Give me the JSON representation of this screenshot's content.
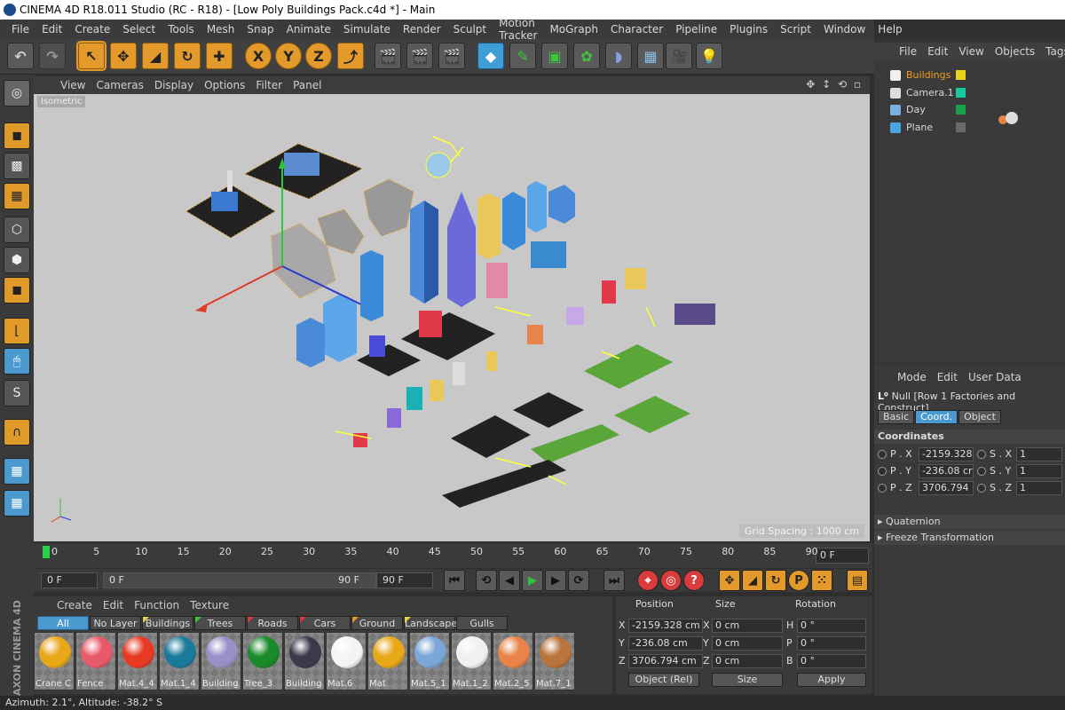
{
  "window": {
    "title": "CINEMA 4D R18.011 Studio (RC - R18) - [Low Poly Buildings Pack.c4d *] - Main"
  },
  "menubar": [
    "File",
    "Edit",
    "Create",
    "Select",
    "Tools",
    "Mesh",
    "Snap",
    "Animate",
    "Simulate",
    "Render",
    "Sculpt",
    "Motion Tracker",
    "MoGraph",
    "Character",
    "Pipeline",
    "Plugins",
    "Script",
    "Window",
    "Help"
  ],
  "viewport": {
    "menu": [
      "View",
      "Cameras",
      "Display",
      "Options",
      "Filter",
      "Panel"
    ],
    "camera_label": "Isometric",
    "grid_spacing": "Grid Spacing : 1000 cm"
  },
  "timeline": {
    "ticks": [
      "0",
      "5",
      "10",
      "15",
      "20",
      "25",
      "30",
      "35",
      "40",
      "45",
      "50",
      "55",
      "60",
      "65",
      "70",
      "75",
      "80",
      "85",
      "90"
    ],
    "current_frame": "0 F"
  },
  "playback": {
    "start": "0 F",
    "range_start": "0 F",
    "range_end": "90 F",
    "end": "90 F"
  },
  "material_manager": {
    "menu": [
      "Create",
      "Edit",
      "Function",
      "Texture"
    ],
    "tabs": [
      {
        "label": "All",
        "flag": ""
      },
      {
        "label": "No Layer",
        "flag": ""
      },
      {
        "label": "Buildings",
        "flag": "#e6d23a"
      },
      {
        "label": "Trees",
        "flag": "#3ac83a"
      },
      {
        "label": "Roads",
        "flag": "#d83c3c"
      },
      {
        "label": "Cars",
        "flag": "#d83c3c"
      },
      {
        "label": "Ground",
        "flag": "#e49a2a"
      },
      {
        "label": "Landscape",
        "flag": "#e6d23a"
      },
      {
        "label": "Gulls",
        "flag": ""
      }
    ],
    "materials": [
      {
        "name": "Crane C",
        "color": "#e8a818"
      },
      {
        "name": "Fence",
        "color": "#e85a6a"
      },
      {
        "name": "Mat.4_4",
        "color": "#e83a22"
      },
      {
        "name": "Mat.1_4",
        "color": "#1a7a9a"
      },
      {
        "name": "Building",
        "color": "#9a90c8"
      },
      {
        "name": "Tree_3",
        "color": "#1a8a2a"
      },
      {
        "name": "Building",
        "color": "#3a3a4a"
      },
      {
        "name": "Mat.6",
        "color": "#f4f4f4"
      },
      {
        "name": "Mat",
        "color": "#e8a818"
      },
      {
        "name": "Mat.5_1",
        "color": "#7aa6d8"
      },
      {
        "name": "Mat.1_2",
        "color": "#f0f0f0"
      },
      {
        "name": "Mat.2_5",
        "color": "#e8844a"
      },
      {
        "name": "Mat.7_1",
        "color": "#b8743a"
      }
    ]
  },
  "coordinates_panel": {
    "headers": [
      "Position",
      "Size",
      "Rotation"
    ],
    "x": {
      "label": "X",
      "pos": "-2159.328 cm",
      "size": "0 cm",
      "rot_label": "H",
      "rot": "0 °"
    },
    "y": {
      "label": "Y",
      "pos": "-236.08 cm",
      "size": "0 cm",
      "rot_label": "P",
      "rot": "0 °"
    },
    "z": {
      "label": "Z",
      "pos": "3706.794 cm",
      "size": "0 cm",
      "rot_label": "B",
      "rot": "0 °"
    },
    "mode": "Object (Rel)",
    "size_mode": "Size",
    "apply": "Apply"
  },
  "object_manager": {
    "menu": [
      "File",
      "Edit",
      "View",
      "Objects",
      "Tags"
    ],
    "objects": [
      {
        "name": "Buildings",
        "color": "#e8d21a",
        "icon_color": "#f0f0f0",
        "highlight": true
      },
      {
        "name": "Camera.1",
        "color": "#1ac8a0",
        "icon_color": "#ddd",
        "highlight": false
      },
      {
        "name": "Day",
        "color": "#1aa04a",
        "icon_color": "#7ab0e0",
        "highlight": false
      },
      {
        "name": "Plane",
        "color": "#6a6a6a",
        "icon_color": "#4aa6e0",
        "highlight": false
      }
    ]
  },
  "attribute_manager": {
    "menu": [
      "Mode",
      "Edit",
      "User Data"
    ],
    "object_label": "Null [Row 1 Factories and Construct]",
    "tabs": [
      "Basic",
      "Coord.",
      "Object"
    ],
    "active_tab": "Coord.",
    "section": "Coordinates",
    "fields": [
      {
        "p_label": "P . X",
        "p_val": "-2159.328",
        "s_label": "S . X",
        "s_val": "1"
      },
      {
        "p_label": "P . Y",
        "p_val": "-236.08 cr",
        "s_label": "S . Y",
        "s_val": "1"
      },
      {
        "p_label": "P . Z",
        "p_val": "3706.794",
        "s_label": "S . Z",
        "s_val": "1"
      }
    ],
    "collapsed": [
      "Quaternion",
      "Freeze Transformation"
    ]
  },
  "status": "Azimuth: 2.1°, Altitude: -38.2°  S",
  "branding": "MAXON CINEMA 4D"
}
